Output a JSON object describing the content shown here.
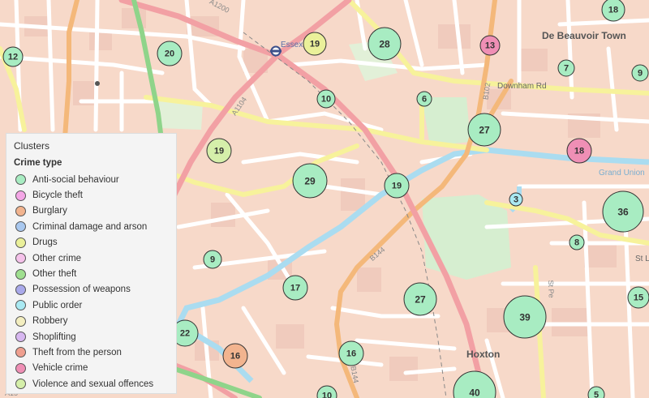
{
  "map": {
    "place_labels": [
      {
        "text": "De Beauvoir Town",
        "key": "de-beauvoir-town"
      },
      {
        "text": "Hoxton",
        "key": "hoxton"
      },
      {
        "text": "Essex",
        "key": "essex"
      }
    ],
    "road_labels": [
      {
        "text": "Downham Rd",
        "key": "downham-rd"
      },
      {
        "text": "Grand Union",
        "key": "grand-union"
      },
      {
        "text": "St L",
        "key": "st-l"
      },
      {
        "text": "B102",
        "key": "b102"
      },
      {
        "text": "A1200",
        "key": "a1200"
      },
      {
        "text": "A1104",
        "key": "a1104"
      },
      {
        "text": "B144",
        "key": "b144-north"
      },
      {
        "text": "B144",
        "key": "b144-south"
      },
      {
        "text": "St Pe",
        "key": "st-pe"
      },
      {
        "text": "A15",
        "key": "a15"
      }
    ],
    "clusters": [
      {
        "count": "19",
        "type": "Drugs"
      },
      {
        "count": "28",
        "type": "Anti-social behaviour"
      },
      {
        "count": "13",
        "type": "Vehicle crime"
      },
      {
        "count": "18",
        "type": "Anti-social behaviour"
      },
      {
        "count": "12",
        "type": "Anti-social behaviour"
      },
      {
        "count": "20",
        "type": "Anti-social behaviour"
      },
      {
        "count": "7",
        "type": "Anti-social behaviour"
      },
      {
        "count": "9",
        "type": "Anti-social behaviour"
      },
      {
        "count": "10",
        "type": "Anti-social behaviour"
      },
      {
        "count": "6",
        "type": "Anti-social behaviour"
      },
      {
        "count": "27",
        "type": "Anti-social behaviour"
      },
      {
        "count": "18",
        "type": "Vehicle crime"
      },
      {
        "count": "19",
        "type": "Violence and sexual offences"
      },
      {
        "count": "29",
        "type": "Anti-social behaviour"
      },
      {
        "count": "19",
        "type": "Anti-social behaviour"
      },
      {
        "count": "3",
        "type": "Public order"
      },
      {
        "count": "36",
        "type": "Anti-social behaviour"
      },
      {
        "count": "8",
        "type": "Anti-social behaviour"
      },
      {
        "count": "9",
        "type": "Anti-social behaviour"
      },
      {
        "count": "17",
        "type": "Anti-social behaviour"
      },
      {
        "count": "27",
        "type": "Anti-social behaviour"
      },
      {
        "count": "39",
        "type": "Anti-social behaviour"
      },
      {
        "count": "15",
        "type": "Anti-social behaviour"
      },
      {
        "count": "22",
        "type": "Anti-social behaviour"
      },
      {
        "count": "16",
        "type": "Burglary"
      },
      {
        "count": "16",
        "type": "Anti-social behaviour"
      },
      {
        "count": "40",
        "type": "Anti-social behaviour"
      },
      {
        "count": "10",
        "type": "Anti-social behaviour"
      },
      {
        "count": "5",
        "type": "Anti-social behaviour"
      }
    ],
    "icons": [
      "underground-station-icon"
    ]
  },
  "legend": {
    "title": "Clusters",
    "subtitle": "Crime type",
    "items": [
      {
        "label": "Anti-social behaviour",
        "color": "#a8ecc2"
      },
      {
        "label": "Bicycle theft",
        "color": "#f4a6e6"
      },
      {
        "label": "Burglary",
        "color": "#f2b48f"
      },
      {
        "label": "Criminal damage and arson",
        "color": "#a9c8ef"
      },
      {
        "label": "Drugs",
        "color": "#eaf09a"
      },
      {
        "label": "Other crime",
        "color": "#f5c2ea"
      },
      {
        "label": "Other theft",
        "color": "#9fdf8f"
      },
      {
        "label": "Possession of weapons",
        "color": "#a9a9ea"
      },
      {
        "label": "Public order",
        "color": "#a9e9f2"
      },
      {
        "label": "Robbery",
        "color": "#f3eec0"
      },
      {
        "label": "Shoplifting",
        "color": "#d7b7f0"
      },
      {
        "label": "Theft from the person",
        "color": "#ef9f8f"
      },
      {
        "label": "Vehicle crime",
        "color": "#ef8fb5"
      },
      {
        "label": "Violence and sexual offences",
        "color": "#d5efaa"
      }
    ]
  },
  "colors": {
    "land": "#f7d9c9",
    "minor_road": "#ffffff",
    "b_road": "#f7f29b",
    "a_road": "#f2a0a4",
    "orange_road": "#f4b87a",
    "green_road": "#8fd48a",
    "water": "#aadcf0",
    "park": "#d6eed0",
    "building": "#f0cbbd"
  }
}
